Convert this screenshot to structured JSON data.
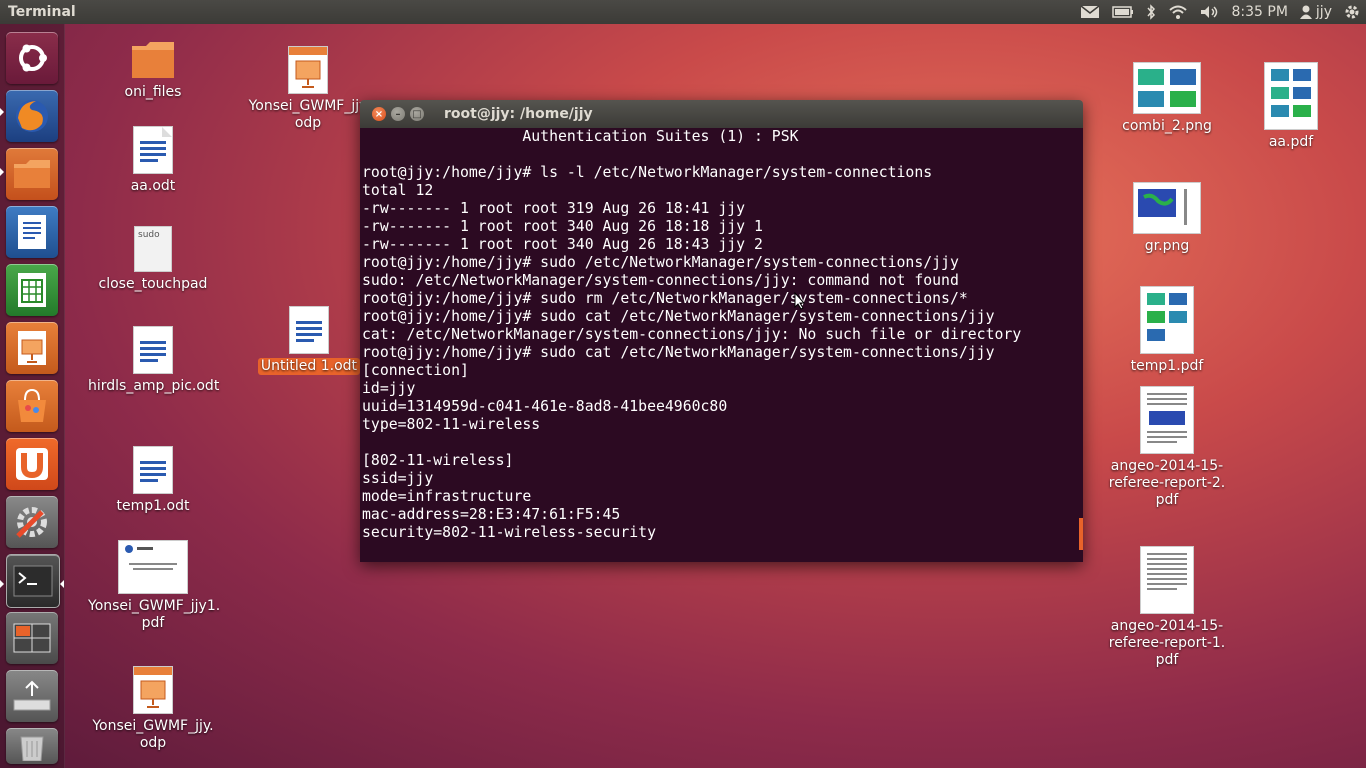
{
  "top_panel": {
    "app_title": "Terminal",
    "clock": "8:35 PM",
    "user": "jjy"
  },
  "terminal": {
    "title": "root@jjy: /home/jjy",
    "lines": [
      "                  Authentication Suites (1) : PSK",
      "",
      "root@jjy:/home/jjy# ls -l /etc/NetworkManager/system-connections",
      "total 12",
      "-rw------- 1 root root 319 Aug 26 18:41 jjy",
      "-rw------- 1 root root 340 Aug 26 18:18 jjy 1",
      "-rw------- 1 root root 340 Aug 26 18:43 jjy 2",
      "root@jjy:/home/jjy# sudo /etc/NetworkManager/system-connections/jjy",
      "sudo: /etc/NetworkManager/system-connections/jjy: command not found",
      "root@jjy:/home/jjy# sudo rm /etc/NetworkManager/system-connections/*",
      "root@jjy:/home/jjy# sudo cat /etc/NetworkManager/system-connections/jjy",
      "cat: /etc/NetworkManager/system-connections/jjy: No such file or directory",
      "root@jjy:/home/jjy# sudo cat /etc/NetworkManager/system-connections/jjy",
      "[connection]",
      "id=jjy",
      "uuid=1314959d-c041-461e-8ad8-41bee4960c80",
      "type=802-11-wireless",
      "",
      "[802-11-wireless]",
      "ssid=jjy",
      "mode=infrastructure",
      "mac-address=28:E3:47:61:F5:45",
      "security=802-11-wireless-security"
    ]
  },
  "desktop": {
    "oni_files": "oni_files",
    "aa_odt": "aa.odt",
    "close_touchpad": "close_touchpad",
    "hirdls": "hirdls_amp_pic.odt",
    "temp1_odt": "temp1.odt",
    "yonsei_pdf": "Yonsei_GWMF_jjy1.\npdf",
    "yonsei_odp": "Yonsei_GWMF_jjy.\nodp",
    "yonsei_odp_top": "Yonsei_GWMF_jjy\nodp",
    "untitled": "Untitled 1.odt",
    "combi": "combi_2.png",
    "aa_pdf": "aa.pdf",
    "gr": "gr.png",
    "temp1_pdf": "temp1.pdf",
    "angeo2": "angeo-2014-15-\nreferee-report-2.\npdf",
    "angeo1": "angeo-2014-15-\nreferee-report-1.\npdf",
    "sudo_text": "sudo"
  },
  "icons": {
    "launcher": [
      "ubuntu-dash-icon",
      "firefox-icon",
      "files-icon",
      "writer-icon",
      "calc-icon",
      "impress-icon",
      "software-center-icon",
      "ubuntu-one-icon",
      "system-settings-icon",
      "terminal-icon",
      "workspace-switcher-icon",
      "usb-drive-icon",
      "trash-icon"
    ]
  },
  "colors": {
    "terminal_bg": "#2c0a22",
    "accent": "#e8632a"
  }
}
